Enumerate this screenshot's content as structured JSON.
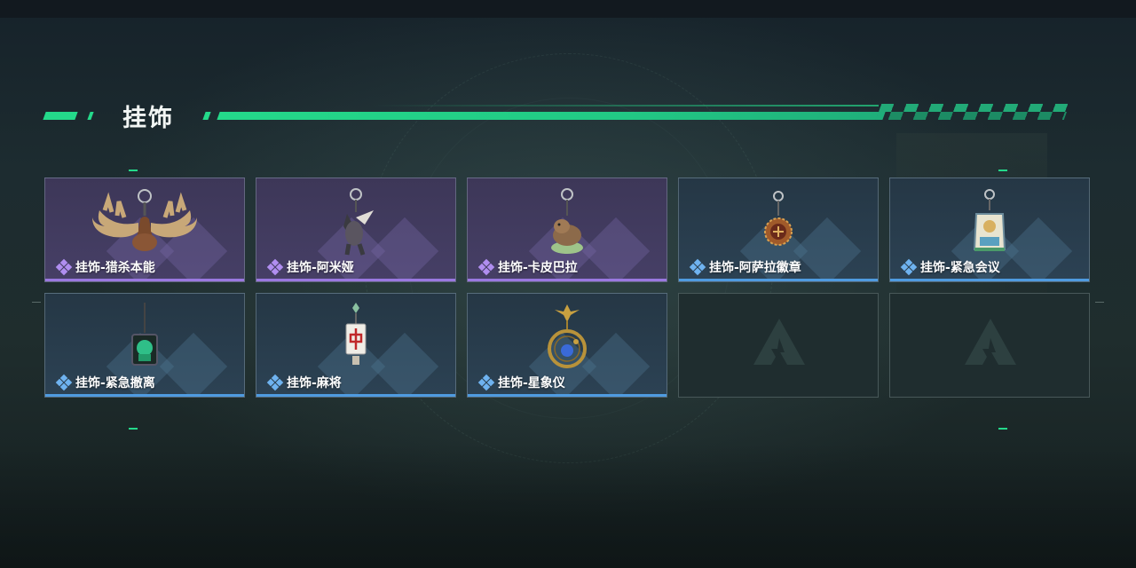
{
  "header": {
    "title": "挂饰"
  },
  "colors": {
    "accent": "#24d98a",
    "purple_rarity": "#9a78e0",
    "blue_rarity": "#4f9be0"
  },
  "items": [
    {
      "label": "挂饰-猎杀本能",
      "rarity": "purple",
      "icon": "moose-antler-charm-icon"
    },
    {
      "label": "挂饰-阿米娅",
      "rarity": "purple",
      "icon": "amiya-doll-charm-icon"
    },
    {
      "label": "挂饰-卡皮巴拉",
      "rarity": "purple",
      "icon": "capybara-charm-icon"
    },
    {
      "label": "挂饰-阿萨拉徽章",
      "rarity": "blue",
      "icon": "asara-badge-charm-icon"
    },
    {
      "label": "挂饰-紧急会议",
      "rarity": "blue",
      "icon": "emergency-meeting-charm-icon"
    },
    {
      "label": "挂饰-紧急撤离",
      "rarity": "blue",
      "icon": "emergency-evac-charm-icon"
    },
    {
      "label": "挂饰-麻将",
      "rarity": "blue",
      "icon": "mahjong-charm-icon"
    },
    {
      "label": "挂饰-星象仪",
      "rarity": "blue",
      "icon": "astrolabe-charm-icon"
    },
    {
      "label": "",
      "rarity": "empty",
      "icon": "delta-logo-placeholder-icon"
    },
    {
      "label": "",
      "rarity": "empty",
      "icon": "delta-logo-placeholder-icon"
    }
  ]
}
